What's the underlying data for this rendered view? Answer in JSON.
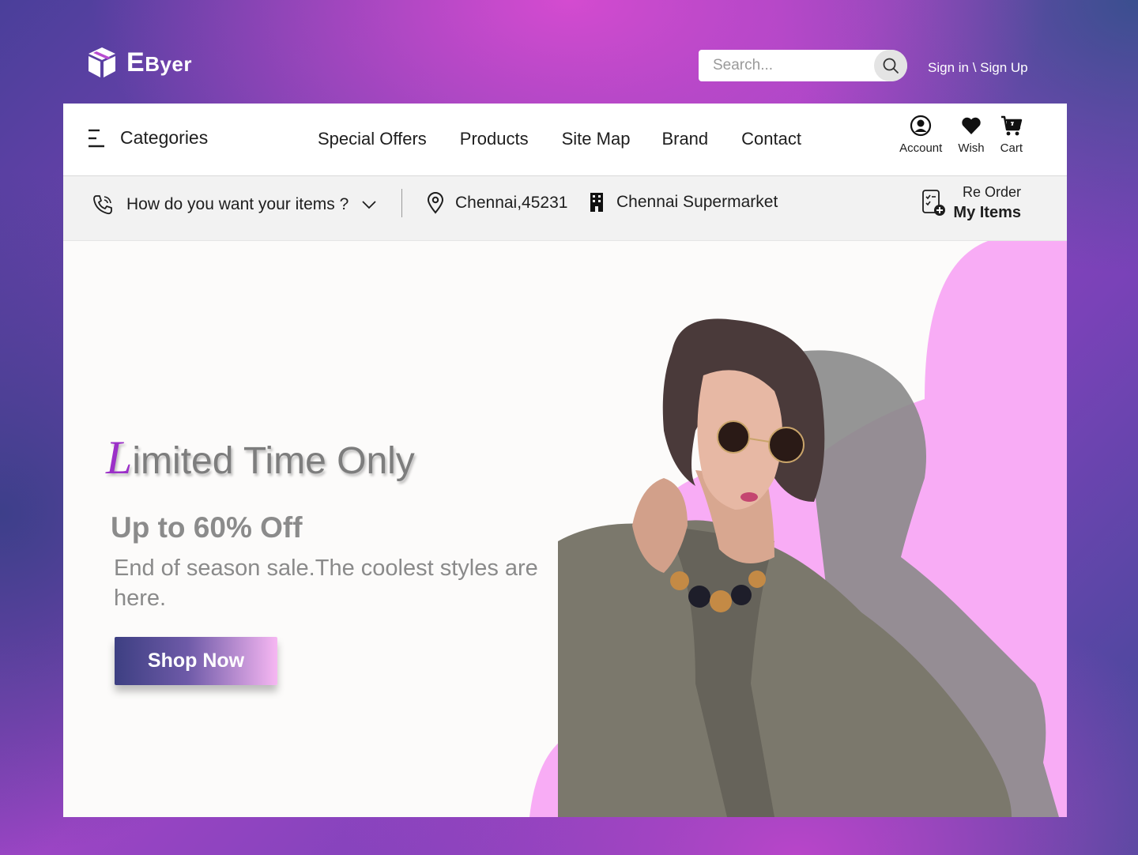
{
  "brand": {
    "name_big": "E",
    "name_small": "Byer"
  },
  "search": {
    "placeholder": "Search..."
  },
  "auth": {
    "label": "Sign in \\ Sign Up"
  },
  "nav": {
    "categories_label": "Categories",
    "links": [
      "Special Offers",
      "Products",
      "Site Map",
      "Brand",
      "Contact"
    ],
    "icons": [
      {
        "label": "Account",
        "icon": "account-icon"
      },
      {
        "label": "Wish",
        "icon": "heart-icon"
      },
      {
        "label": "Cart",
        "icon": "cart-icon"
      }
    ]
  },
  "subbar": {
    "delivery_prompt": "How do you want your items ?",
    "location": "Chennai,45231",
    "store": "Chennai Supermarket",
    "reorder_top": "Re Order",
    "reorder_bottom": "My Items"
  },
  "hero": {
    "headline_first": "L",
    "headline_rest": "imited Time Only",
    "offer": "Up to 60% Off",
    "description": "End of season sale.The coolest styles are here.",
    "cta": "Shop Now"
  },
  "colors": {
    "accent": "#9b30c8",
    "pink_blob": "#f7aaf6",
    "button_start": "#3d3f82",
    "button_end": "#f6b7f2"
  }
}
